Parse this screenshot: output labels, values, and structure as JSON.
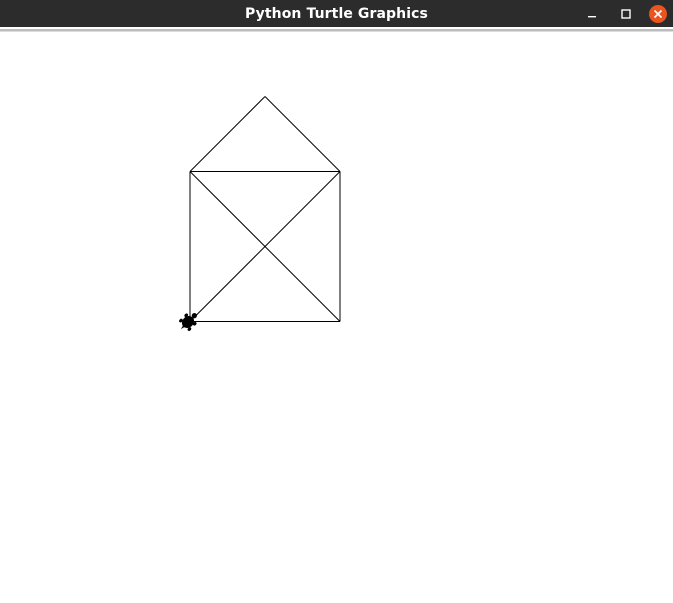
{
  "window": {
    "title": "Python Turtle Graphics"
  },
  "icons": {
    "minimize": "minimize-icon",
    "maximize": "maximize-icon",
    "close": "close-icon",
    "turtle": "turtle-cursor-icon"
  },
  "colors": {
    "titlebar_bg": "#2c2c2c",
    "title_text": "#ffffff",
    "close_button": "#e95420",
    "canvas_bg": "#ffffff",
    "pen": "#000000"
  }
}
